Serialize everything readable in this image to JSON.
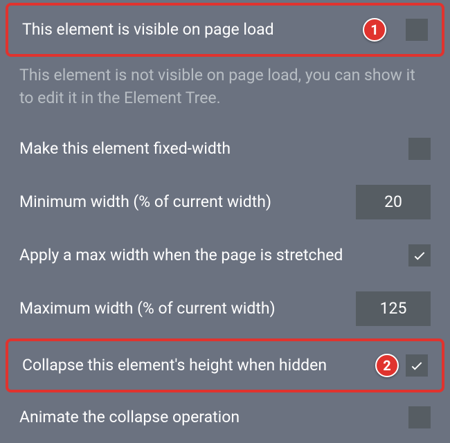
{
  "rows": {
    "visible_on_load": {
      "label": "This element is visible on page load",
      "checked": false,
      "badge": "1"
    },
    "hint_not_visible": "This element is not visible on page load, you can show it to edit it in the Element Tree.",
    "fixed_width": {
      "label": "Make this element fixed-width",
      "checked": false
    },
    "min_width": {
      "label": "Minimum width (% of current width)",
      "value": "20"
    },
    "apply_max_width": {
      "label": "Apply a max width when the page is stretched",
      "checked": true
    },
    "max_width": {
      "label": "Maximum width (% of current width)",
      "value": "125"
    },
    "collapse_when_hidden": {
      "label": "Collapse this element's height when hidden",
      "checked": true,
      "badge": "2"
    },
    "animate_collapse": {
      "label": "Animate the collapse operation",
      "checked": false
    }
  }
}
